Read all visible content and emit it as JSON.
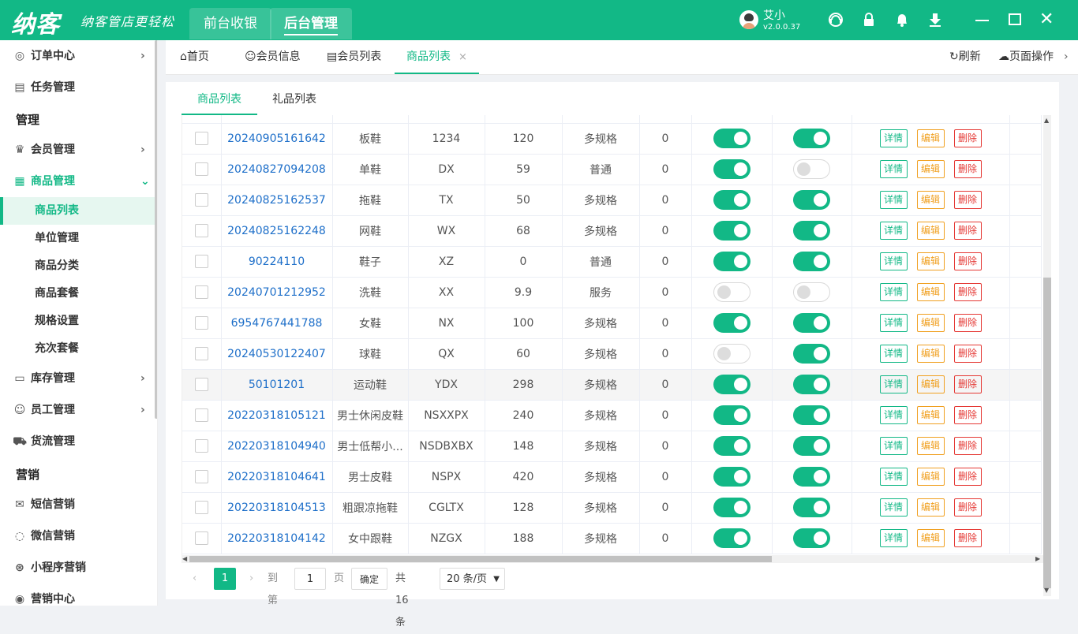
{
  "app": {
    "logo": "纳客",
    "slogan": "纳客管店更轻松",
    "top_tabs": [
      "前台收银",
      "后台管理"
    ],
    "active_top_tab": 1,
    "user_name": "艾小",
    "version": "v2.0.0.37"
  },
  "sidebar": {
    "order_center": "订单中心",
    "task_mgmt": "任务管理",
    "section_manage": "管理",
    "member_mgmt": "会员管理",
    "goods_mgmt": "商品管理",
    "sub": [
      "商品列表",
      "单位管理",
      "商品分类",
      "商品套餐",
      "规格设置",
      "充次套餐"
    ],
    "stock_mgmt": "库存管理",
    "staff_mgmt": "员工管理",
    "freight_mgmt": "货流管理",
    "section_marketing": "营销",
    "sms_marketing": "短信营销",
    "wechat_marketing": "微信营销",
    "mini_marketing": "小程序营销",
    "marketing_center": "营销中心"
  },
  "page_tabs": {
    "home": "首页",
    "member_info": "会员信息",
    "member_list": "会员列表",
    "goods_list": "商品列表",
    "close": "×",
    "refresh": "刷新",
    "page_ops": "页面操作"
  },
  "content_tabs": [
    "商品列表",
    "礼品列表"
  ],
  "buttons": {
    "detail": "详情",
    "edit": "编辑",
    "delete": "删除"
  },
  "rows": [
    {
      "code": "20240905161642",
      "name": "板鞋",
      "abbr": "1234",
      "price": "120",
      "type": "多规格",
      "stock": "0",
      "sw1": true,
      "sw2": true
    },
    {
      "code": "20240827094208",
      "name": "单鞋",
      "abbr": "DX",
      "price": "59",
      "type": "普通",
      "stock": "0",
      "sw1": true,
      "sw2": false
    },
    {
      "code": "20240825162537",
      "name": "拖鞋",
      "abbr": "TX",
      "price": "50",
      "type": "多规格",
      "stock": "0",
      "sw1": true,
      "sw2": true
    },
    {
      "code": "20240825162248",
      "name": "网鞋",
      "abbr": "WX",
      "price": "68",
      "type": "多规格",
      "stock": "0",
      "sw1": true,
      "sw2": true
    },
    {
      "code": "90224110",
      "name": "鞋子",
      "abbr": "XZ",
      "price": "0",
      "type": "普通",
      "stock": "0",
      "sw1": true,
      "sw2": true
    },
    {
      "code": "20240701212952",
      "name": "洗鞋",
      "abbr": "XX",
      "price": "9.9",
      "type": "服务",
      "stock": "0",
      "sw1": false,
      "sw2": false
    },
    {
      "code": "6954767441788",
      "name": "女鞋",
      "abbr": "NX",
      "price": "100",
      "type": "多规格",
      "stock": "0",
      "sw1": true,
      "sw2": true
    },
    {
      "code": "20240530122407",
      "name": "球鞋",
      "abbr": "QX",
      "price": "60",
      "type": "多规格",
      "stock": "0",
      "sw1": false,
      "sw2": true
    },
    {
      "code": "50101201",
      "name": "运动鞋",
      "abbr": "YDX",
      "price": "298",
      "type": "多规格",
      "stock": "0",
      "sw1": true,
      "sw2": true
    },
    {
      "code": "20220318105121",
      "name": "男士休闲皮鞋",
      "abbr": "NSXXPX",
      "price": "240",
      "type": "多规格",
      "stock": "0",
      "sw1": true,
      "sw2": true
    },
    {
      "code": "20220318104940",
      "name": "男士低帮小...",
      "abbr": "NSDBXBX",
      "price": "148",
      "type": "多规格",
      "stock": "0",
      "sw1": true,
      "sw2": true
    },
    {
      "code": "20220318104641",
      "name": "男士皮鞋",
      "abbr": "NSPX",
      "price": "420",
      "type": "多规格",
      "stock": "0",
      "sw1": true,
      "sw2": true
    },
    {
      "code": "20220318104513",
      "name": "粗跟凉拖鞋",
      "abbr": "CGLTX",
      "price": "128",
      "type": "多规格",
      "stock": "0",
      "sw1": true,
      "sw2": true
    },
    {
      "code": "20220318104142",
      "name": "女中跟鞋",
      "abbr": "NZGX",
      "price": "188",
      "type": "多规格",
      "stock": "0",
      "sw1": true,
      "sw2": true
    }
  ],
  "highlight_row": 8,
  "pager": {
    "current": "1",
    "goto_label": "到第",
    "goto_value": "1",
    "page_unit": "页",
    "confirm": "确定",
    "total": "共 16 条",
    "page_size": "20 条/页"
  },
  "colors": {
    "accent": "#12b886",
    "link": "#1e6fc9",
    "edit": "#f0a020",
    "delete": "#e53935"
  }
}
